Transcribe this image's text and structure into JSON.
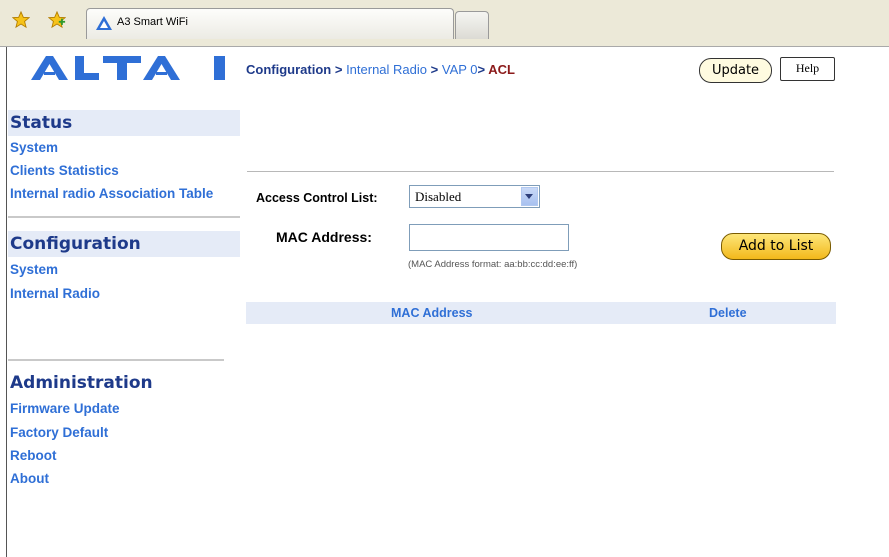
{
  "browser": {
    "tab_title": "A3 Smart WiFi"
  },
  "logo": {
    "text": "ALTAI",
    "color": "#2f6fd6"
  },
  "sidebar": {
    "status": {
      "heading": "Status",
      "items": [
        {
          "label": "System"
        },
        {
          "label": "Clients Statistics"
        },
        {
          "label": "Internal radio Association Table"
        }
      ]
    },
    "configuration": {
      "heading": "Configuration",
      "items": [
        {
          "label": "System"
        },
        {
          "label": "Internal Radio"
        }
      ]
    },
    "administration": {
      "heading": "Administration",
      "items": [
        {
          "label": "Firmware Update"
        },
        {
          "label": "Factory Default"
        },
        {
          "label": "Reboot"
        },
        {
          "label": "About"
        }
      ]
    }
  },
  "breadcrumb": {
    "root": "Configuration",
    "sep1": ">",
    "level2": "Internal Radio",
    "sep2": ">",
    "level3": "VAP 0",
    "sep3": ">",
    "current": "ACL"
  },
  "toolbar": {
    "update_label": "Update",
    "help_label": "Help"
  },
  "form": {
    "acl_label": "Access Control List:",
    "acl_value": "Disabled",
    "mac_label": "MAC Address:",
    "mac_value": "",
    "mac_hint": "(MAC Address format: aa:bb:cc:dd:ee:ff)",
    "add_label": "Add to List"
  },
  "table": {
    "columns": [
      "MAC Address",
      "Delete"
    ],
    "rows": []
  },
  "colors": {
    "heading_blue": "#1e3a8a",
    "link_blue": "#2f6fd6",
    "section_bg": "#e5ebf7",
    "current_crumb": "#8b1a1a",
    "add_button": "#f2b81b"
  }
}
